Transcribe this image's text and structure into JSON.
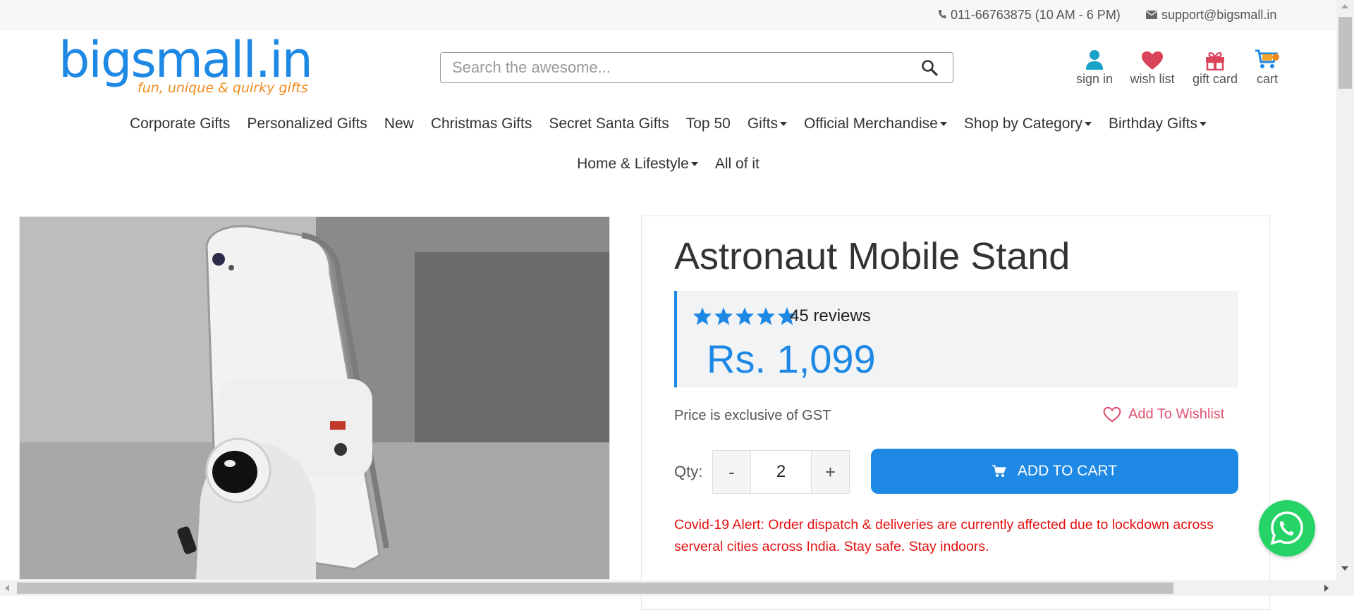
{
  "topbar": {
    "phone": "011-66763875 (10 AM - 6 PM)",
    "email": "support@bigsmall.in"
  },
  "logo": {
    "brand": "bigsmall.in",
    "tagline": "fun, unique & quirky gifts"
  },
  "search": {
    "placeholder": "Search the awesome..."
  },
  "header_links": {
    "signin": "sign in",
    "wishlist": "wish list",
    "giftcard": "gift card",
    "cart": "cart"
  },
  "nav": {
    "row1": [
      "Corporate Gifts",
      "Personalized Gifts",
      "New",
      "Christmas Gifts",
      "Secret Santa Gifts",
      "Top 50",
      "Gifts",
      "Official Merchandise",
      "Shop by Category",
      "Birthday Gifts"
    ],
    "row2": [
      "Home & Lifestyle",
      "All of it"
    ]
  },
  "product": {
    "title": "Astronaut Mobile Stand",
    "rating_stars": 5,
    "reviews": "45 reviews",
    "price": "Rs. 1,099",
    "gst_note": "Price is exclusive of GST",
    "wishlist_label": "Add To Wishlist",
    "qty_label": "Qty:",
    "qty_minus": "-",
    "qty_plus": "+",
    "qty_value": "2",
    "add_to_cart": "ADD TO CART",
    "covid_alert": "Covid-19 Alert: Order dispatch & deliveries are currently affected due to lockdown across serveral cities across India. Stay safe. Stay indoors."
  },
  "colors": {
    "brand_blue": "#1e88e5",
    "brand_orange": "#f08a1c",
    "alert_red": "#e31010",
    "wish_pink": "#e0556f",
    "whatsapp_green": "#25d366"
  }
}
